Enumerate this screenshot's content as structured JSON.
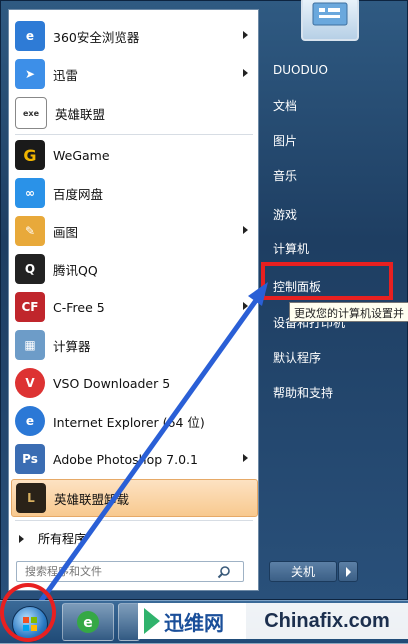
{
  "programs": [
    {
      "label": "360安全浏览器",
      "icon": "browser-360-icon",
      "arrow": true
    },
    {
      "label": "迅雷",
      "icon": "xunlei-icon",
      "arrow": true
    },
    {
      "label": "英雄联盟",
      "icon": "lol-icon",
      "arrow": false
    },
    {
      "label": "WeGame",
      "icon": "wegame-icon",
      "arrow": false
    },
    {
      "label": "百度网盘",
      "icon": "baidu-netdisk-icon",
      "arrow": false
    },
    {
      "label": "画图",
      "icon": "paint-icon",
      "arrow": true
    },
    {
      "label": "腾讯QQ",
      "icon": "qq-icon",
      "arrow": false
    },
    {
      "label": "C-Free 5",
      "icon": "cfree-icon",
      "arrow": true
    },
    {
      "label": "计算器",
      "icon": "calculator-icon",
      "arrow": false
    },
    {
      "label": "VSO Downloader 5",
      "icon": "vso-icon",
      "arrow": false
    },
    {
      "label": "Internet Explorer (64 位)",
      "icon": "ie-icon",
      "arrow": false
    },
    {
      "label": "Adobe Photoshop 7.0.1",
      "icon": "photoshop-icon",
      "arrow": true
    },
    {
      "label": "英雄联盟卸载",
      "icon": "lol-uninstall-icon",
      "arrow": false
    }
  ],
  "all_programs": "所有程序",
  "search": {
    "placeholder": "搜索程序和文件"
  },
  "right": {
    "user": "DUODUO",
    "items": [
      "文档",
      "图片",
      "音乐",
      "游戏",
      "计算机",
      "控制面板",
      "设备和打印机",
      "默认程序",
      "帮助和支持"
    ]
  },
  "tooltip": "更改您的计算机设置并",
  "shutdown_label": "关机",
  "watermark": {
    "left": "迅维网",
    "right": "Chinafix.com"
  },
  "colors": {
    "accent_red": "#e82020",
    "highlight": "#f8c98f"
  }
}
